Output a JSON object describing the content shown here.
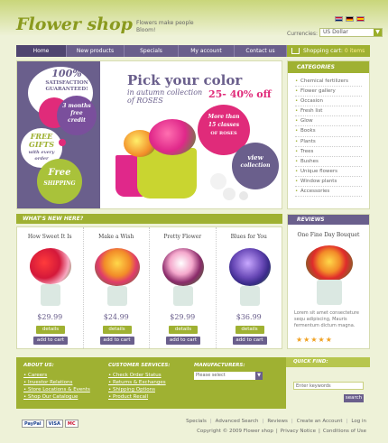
{
  "header": {
    "logo": "Flower shop",
    "tagline": "Flowers make people Bloom!",
    "currency_label": "Currencies:",
    "currency_value": "US Dollar",
    "cart_label": "Shopping cart:",
    "cart_count": "0 items"
  },
  "nav": {
    "items": [
      {
        "label": "Home"
      },
      {
        "label": "New products"
      },
      {
        "label": "Specials"
      },
      {
        "label": "My account"
      },
      {
        "label": "Contact us"
      }
    ]
  },
  "banner": {
    "guarantee_pct": "100%",
    "guarantee_text1": "SATISFACTION",
    "guarantee_text2": "GUARANTEED!",
    "credit_text1": "3 months",
    "credit_text2": "free",
    "credit_text3": "credit",
    "gifts_text1": "FREE",
    "gifts_text2": "GIFTS",
    "gifts_text3": "with every",
    "gifts_text4": "order",
    "shipping_text1": "Free",
    "shipping_text2": "SHIPPING",
    "headline": "Pick your color",
    "sub1": "in autumn collection",
    "sub2": "of ROSES",
    "percent": "25- 40% off",
    "classes1": "More than",
    "classes2": "15 classes",
    "classes3": "OF ROSES",
    "view1": "view",
    "view2": "collection"
  },
  "categories": {
    "heading": "CATEGORIES",
    "items": [
      "Chemical fertilizers",
      "Flower gallery",
      "Occasion",
      "Fresh list",
      "Glow",
      "Books",
      "Plants",
      "Trees",
      "Bushes",
      "Unique flowers",
      "Window plants",
      "Accessories"
    ]
  },
  "whats_new": {
    "heading": "WHAT'S NEW HERE?",
    "details_label": "details",
    "add_label": "add to cart",
    "products": [
      {
        "name": "How Sweet It Is",
        "price": "$29.99"
      },
      {
        "name": "Make a Wish",
        "price": "$24.99"
      },
      {
        "name": "Pretty Flower",
        "price": "$29.99"
      },
      {
        "name": "Blues for You",
        "price": "$36.99"
      }
    ]
  },
  "reviews": {
    "heading": "REVIEWS",
    "title": "One Fine Day Bouquet",
    "text": "Lorem sit amet consecteture sequ adipiscing, Mauris fermentum dictum magna.",
    "stars": "★★★★★"
  },
  "footer": {
    "about_heading": "ABOUT US:",
    "about_links": [
      "Careers",
      "Investor Relations",
      "Store Locations & Events",
      "Shop Our Catalogue"
    ],
    "services_heading": "CUSTOMER SERVICES:",
    "services_links": [
      "Check Order Status",
      "Returns & Exchanges",
      "Shipping Options",
      "Product Recall"
    ],
    "manufacturers_heading": "MANUFACTURERS:",
    "manufacturers_select": "Please select",
    "quickfind_heading": "QUICK FIND:",
    "quickfind_placeholder": "Enter keywords",
    "search_label": "search"
  },
  "bottom": {
    "payments": [
      "PayPal",
      "VISA",
      "MC"
    ],
    "links": [
      "Specials",
      "Advanced Search",
      "Reviews",
      "Create an Account",
      "Log in"
    ],
    "copyright": "Copyright © 2009 Flower shop",
    "privacy": "Privacy Notice",
    "conditions": "Conditions of Use"
  },
  "colors": {
    "green": "#9fb132",
    "purple": "#6a5f8c",
    "pink": "#e02b7a"
  }
}
